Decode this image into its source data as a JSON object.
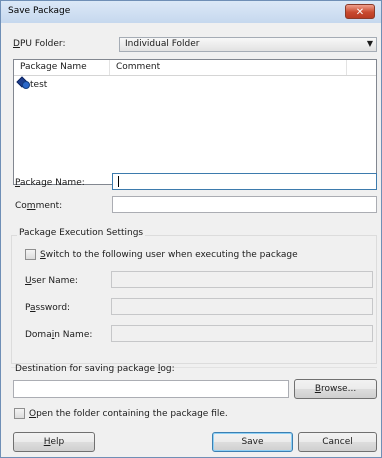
{
  "window": {
    "title": "Save Package",
    "close_glyph": "✕"
  },
  "dpu_folder": {
    "label_mnemonic": "D",
    "label_rest": "PU Folder:",
    "selected": "Individual Folder",
    "arrow_glyph": "▼"
  },
  "package_list": {
    "columns": [
      "Package Name",
      "Comment"
    ],
    "rows": [
      {
        "name": "test",
        "comment": "",
        "icon": "package-icon"
      }
    ]
  },
  "package_name": {
    "label_mnemonic": "P",
    "label_rest": "ackage Name:",
    "value": ""
  },
  "comment": {
    "label_pre": "Co",
    "label_mnemonic": "m",
    "label_rest": "ment:",
    "value": ""
  },
  "execution_settings": {
    "title": "Package Execution Settings",
    "switch_user": {
      "label_mnemonic": "S",
      "label_rest": "witch to the following user when executing the package",
      "checked": false
    },
    "user_name": {
      "label_mnemonic": "U",
      "label_rest": "ser Name:"
    },
    "password": {
      "label_pre": "P",
      "label_mnemonic": "a",
      "label_rest": "ssword:"
    },
    "domain_name": {
      "label_pre": "Doma",
      "label_mnemonic": "i",
      "label_rest": "n Name:"
    }
  },
  "destination": {
    "label_pre": "Destination for saving package ",
    "label_mnemonic": "l",
    "label_rest": "og:",
    "value": "",
    "browse_mnemonic": "B",
    "browse_rest": "rowse..."
  },
  "open_folder": {
    "label_mnemonic": "O",
    "label_rest": "pen the folder containing the package file.",
    "checked": false
  },
  "buttons": {
    "help_mnemonic": "H",
    "help_rest": "elp",
    "save": "Save",
    "cancel": "Cancel"
  }
}
